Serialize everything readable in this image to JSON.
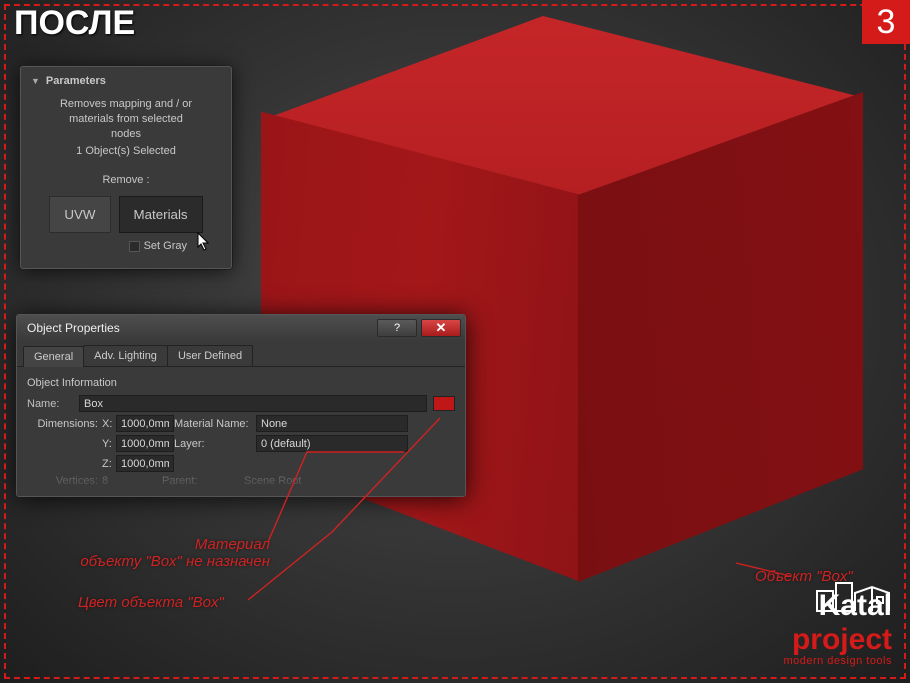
{
  "overlay": {
    "title": "ПОСЛЕ",
    "step": "3"
  },
  "params_panel": {
    "header": "Parameters",
    "desc_line1": "Removes mapping and / or",
    "desc_line2": "materials from selected",
    "desc_line3": "nodes",
    "selected": "1 Object(s) Selected",
    "remove_label": "Remove :",
    "btn_uvw": "UVW",
    "btn_materials": "Materials",
    "chk_gray": "Set Gray"
  },
  "dialog": {
    "title": "Object Properties",
    "tabs": [
      "General",
      "Adv. Lighting",
      "User Defined"
    ],
    "section": "Object Information",
    "name_label": "Name:",
    "name_value": "Box",
    "dim_label": "Dimensions:",
    "dim_x_label": "X:",
    "dim_y_label": "Y:",
    "dim_z_label": "Z:",
    "dim_x": "1000,0mm",
    "dim_y": "1000,0mm",
    "dim_z": "1000,0mm",
    "matname_label": "Material Name:",
    "matname": "None",
    "layer_label": "Layer:",
    "layer": "0 (default)",
    "vertices_label": "Vertices:",
    "vertices": "8",
    "parent_label": "Parent:",
    "parent": "Scene Root",
    "color_swatch": "#bf1717"
  },
  "annotations": {
    "material": "Материал\nобъекту \"Box\" не назначен",
    "color": "Цвет объекта \"Box\"",
    "object": "Объект \"Box\""
  },
  "branding": {
    "name1": "Katal",
    "name2": "project",
    "subtitle": "modern design tools"
  }
}
